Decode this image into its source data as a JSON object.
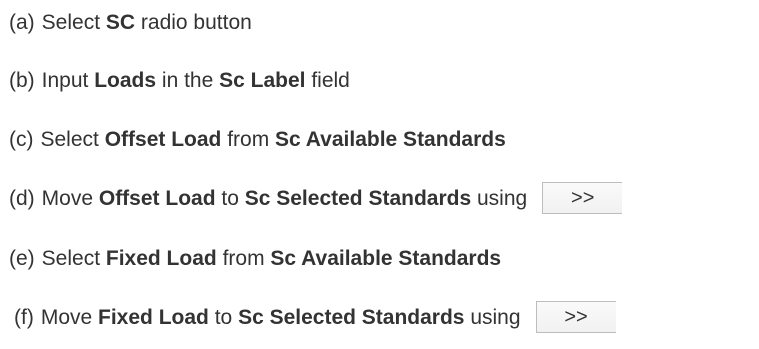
{
  "steps": [
    {
      "marker": "(a)",
      "parts": [
        "Select ",
        "SC",
        " radio button"
      ]
    },
    {
      "marker": "(b)",
      "parts": [
        "Input ",
        "Loads",
        " in the ",
        "Sc Label",
        " field"
      ]
    },
    {
      "marker": "(c)",
      "parts": [
        "Select ",
        "Offset Load",
        " from ",
        "Sc Available Standards"
      ]
    },
    {
      "marker": "(d)",
      "parts": [
        "Move ",
        "Offset Load",
        " to ",
        "Sc Selected Standards",
        " using"
      ],
      "button": ">>"
    },
    {
      "marker": "(e)",
      "parts": [
        "Select ",
        "Fixed Load",
        " from ",
        "Sc Available Standards"
      ]
    },
    {
      "marker": "(f)",
      "parts": [
        "Move ",
        "Fixed Load",
        " to ",
        "Sc Selected Standards",
        " using"
      ],
      "button": ">>"
    }
  ]
}
